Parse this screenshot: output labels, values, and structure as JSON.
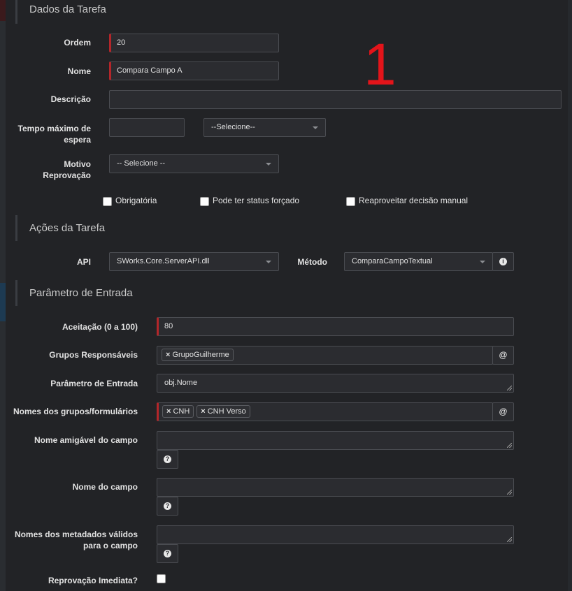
{
  "annotation": "1",
  "sections": {
    "dados": "Dados da Tarefa",
    "acoes": "Ações da Tarefa",
    "parametro": "Parâmetro de Entrada"
  },
  "labels": {
    "ordem": "Ordem",
    "nome": "Nome",
    "descricao": "Descrição",
    "tempo_l1": "Tempo máximo de",
    "tempo_l2": "espera",
    "motivo_l1": "Motivo",
    "motivo_l2": "Reprovação",
    "api": "API",
    "metodo": "Método",
    "aceitacao": "Aceitação (0 a 100)",
    "grupos": "Grupos Responsáveis",
    "parametro": "Parâmetro de Entrada",
    "nomes_grupos": "Nomes dos grupos/formulários",
    "nome_amigavel": "Nome amigável do campo",
    "nome_campo": "Nome do campo",
    "metadados_l1": "Nomes dos metadados válidos",
    "metadados_l2": "para o campo",
    "reprovacao": "Reprovação Imediata?"
  },
  "values": {
    "ordem": "20",
    "nome": "Compara Campo A",
    "descricao": "",
    "tempo": "",
    "tempo_unit": "--Selecione--",
    "motivo": "-- Selecione --",
    "api": "SWorks.Core.ServerAPI.dll",
    "metodo": "ComparaCampoTextual",
    "aceitacao": "80",
    "grupos_tags": [
      "GrupoGuilherme"
    ],
    "parametro": "obj.Nome",
    "nomes_grupos_tags": [
      "CNH",
      "CNH Verso"
    ]
  },
  "checkboxes": {
    "obrigatoria": "Obrigatória",
    "status_forcado": "Pode ter status forçado",
    "reaproveitar": "Reaproveitar decisão manual"
  },
  "icons": {
    "tag_remove": "×",
    "at": "@",
    "info": "i",
    "help": "?"
  }
}
